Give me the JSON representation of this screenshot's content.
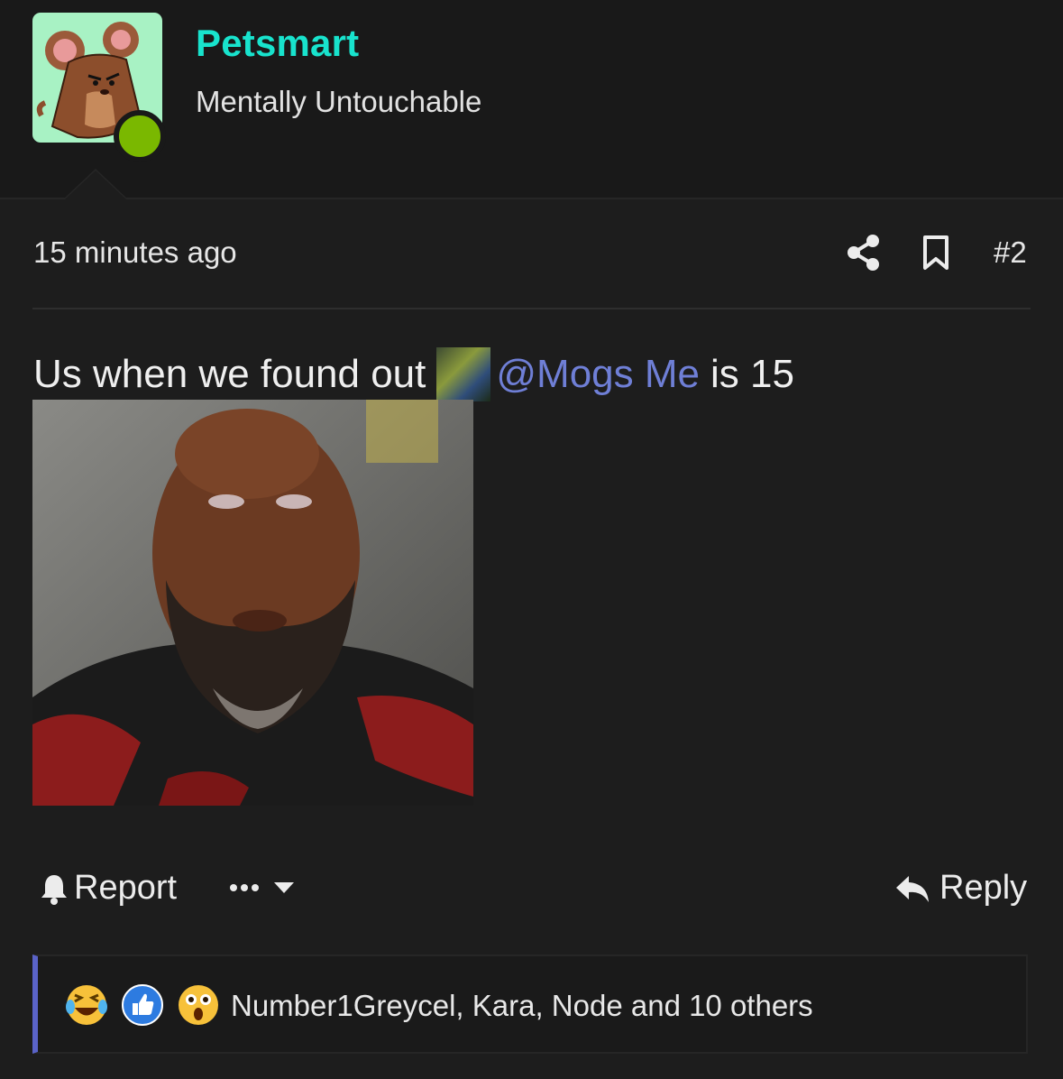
{
  "post": {
    "author": {
      "name": "Petsmart",
      "title": "Mentally Untouchable",
      "avatar_icon": "mouse-avatar-icon",
      "online_color": "#7ab800",
      "name_color": "#18e3cd"
    },
    "timestamp": "15 minutes ago",
    "post_number": "#2",
    "content": {
      "text_before": "Us when we found out",
      "mention": "@Mogs Me",
      "text_after": "is 15",
      "mention_color": "#6f7fd6"
    },
    "actions": {
      "report_label": "Report",
      "more_label": "•••",
      "reply_label": "Reply"
    },
    "reactions": {
      "icons": [
        "laugh-cry-icon",
        "thumbs-up-icon",
        "shocked-icon"
      ],
      "summary": "Number1Greycel, Kara, Node and 10 others",
      "accent": "#5a63c8"
    }
  }
}
